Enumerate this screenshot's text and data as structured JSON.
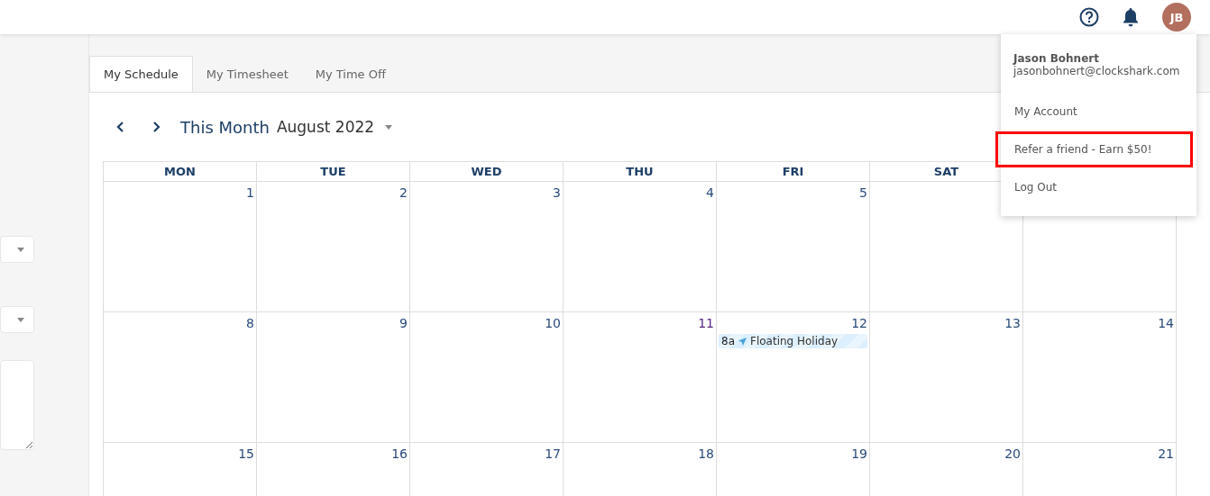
{
  "header": {
    "avatar_initials": "JB"
  },
  "user_menu": {
    "name": "Jason Bohnert",
    "email": "jasonbohnert@clockshark.com",
    "items": [
      {
        "label": "My Account",
        "highlighted": false
      },
      {
        "label": "Refer a friend - Earn $50!",
        "highlighted": true
      },
      {
        "label": "Log Out",
        "highlighted": false
      }
    ]
  },
  "tabs": [
    {
      "label": "My Schedule",
      "selected": true
    },
    {
      "label": "My Timesheet",
      "selected": false
    },
    {
      "label": "My Time Off",
      "selected": false
    }
  ],
  "calendar": {
    "title": "This Month",
    "period": "August 2022",
    "days_of_week": [
      "MON",
      "TUE",
      "WED",
      "THU",
      "FRI",
      "SAT"
    ],
    "weeks": [
      [
        {
          "day": "1",
          "today": false
        },
        {
          "day": "2",
          "today": false
        },
        {
          "day": "3",
          "today": false
        },
        {
          "day": "4",
          "today": false
        },
        {
          "day": "5",
          "today": false
        }
      ],
      [
        {
          "day": "8",
          "today": false
        },
        {
          "day": "9",
          "today": false
        },
        {
          "day": "10",
          "today": false
        },
        {
          "day": "11",
          "today": true
        },
        {
          "day": "12",
          "today": false,
          "events": [
            {
              "time": "8a",
              "title": "Floating Holiday"
            }
          ]
        },
        {
          "day": "13",
          "today": false
        },
        {
          "day": "14",
          "today": false
        }
      ],
      [
        {
          "day": "15",
          "today": false
        },
        {
          "day": "16",
          "today": false
        },
        {
          "day": "17",
          "today": false
        },
        {
          "day": "18",
          "today": false
        },
        {
          "day": "19",
          "today": false
        },
        {
          "day": "20",
          "today": false
        },
        {
          "day": "21",
          "today": false
        }
      ]
    ]
  }
}
